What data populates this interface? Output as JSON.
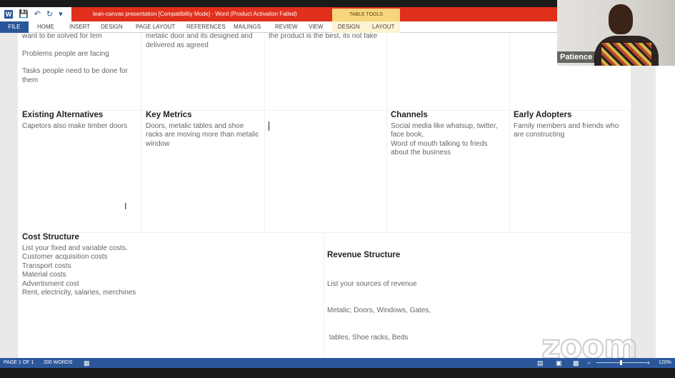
{
  "window": {
    "title": "lean-canvas presentation [Compatibility Mode] - Word (Product Activation Failed)",
    "contextual_tab_group": "TABLE TOOLS"
  },
  "ribbon": {
    "tabs": [
      "FILE",
      "HOME",
      "INSERT",
      "DESIGN",
      "PAGE LAYOUT",
      "REFERENCES",
      "MAILINGS",
      "REVIEW",
      "VIEW",
      "DESIGN",
      "LAYOUT"
    ]
  },
  "canvas": {
    "problem_col_lines": [
      "want to be solved for tem",
      "Problems people are facing",
      "Tasks people need to be done for them"
    ],
    "solution_col_lines": [
      "metalic door and its designed and delivered as agreed"
    ],
    "uvp_col_lines": [
      "the product is the best, its not fake"
    ],
    "existing_alternatives": {
      "title": "Existing Alternatives",
      "lines": [
        "Capetors also make timber doors"
      ]
    },
    "key_metrics": {
      "title": "Key Metrics",
      "lines": [
        "Doors, metalic tables and shoe racks  are moving more than metalic window"
      ]
    },
    "channels": {
      "title": "Channels",
      "lines": [
        "Social media like whatsup, twitter, face book,",
        "Word of mouth talking to frieds about the business"
      ]
    },
    "early_adopters": {
      "title": "Early Adopters",
      "lines": [
        "Family members and friends who are constructing"
      ]
    },
    "cost_structure": {
      "title": "Cost Structure",
      "lines": [
        "List your fixed and variable costs.",
        "Customer acquisition costs",
        "Transport costs",
        "Material costs",
        "Advertisment cost",
        "Rent, electricity, salaries, merchines"
      ]
    },
    "revenue_structure": {
      "title": "Revenue Structure",
      "lines": [
        "List your sources of revenue",
        "Metalic; Doors, Windows, Gates,",
        " tables, Shoe racks, Beds"
      ]
    }
  },
  "statusbar": {
    "page": "PAGE 1 OF 1",
    "words": "200 WORDS",
    "zoom": "120%"
  },
  "video": {
    "participant_name": "Patience"
  },
  "watermark": "zoom"
}
